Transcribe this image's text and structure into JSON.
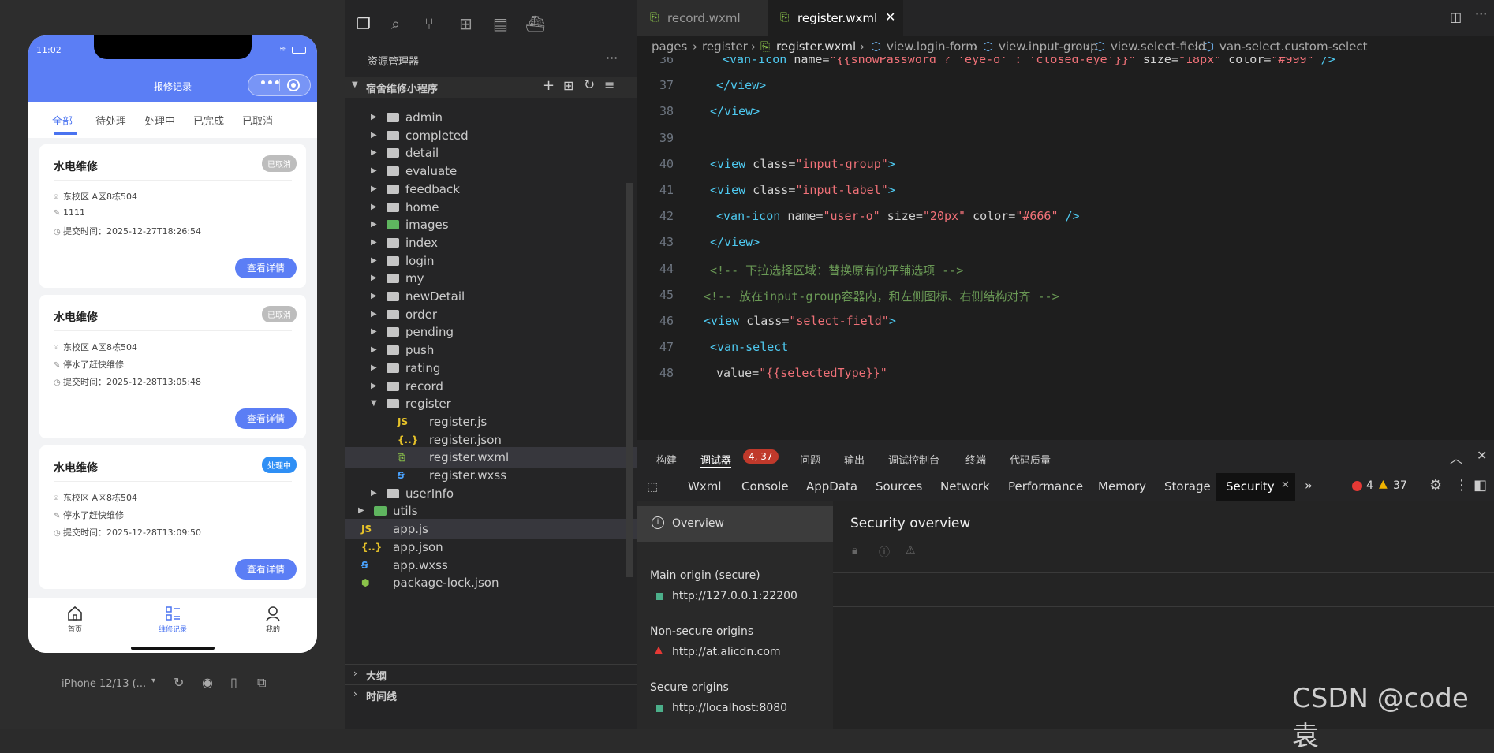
{
  "simulator": {
    "status_time": "11:02",
    "nav_title": "报修记录",
    "tabs": [
      "全部",
      "待处理",
      "处理中",
      "已完成",
      "已取消"
    ],
    "cards": [
      {
        "title": "水电维修",
        "badge": "已取消",
        "badge_color": "#bdbdbd",
        "location": "东校区 A区8栋504",
        "desc": "1111",
        "time": "提交时间：2025-12-27T18:26:54",
        "button": "查看详情"
      },
      {
        "title": "水电维修",
        "badge": "已取消",
        "badge_color": "#bdbdbd",
        "location": "东校区 A区8栋504",
        "desc": "停水了赶快维修",
        "time": "提交时间：2025-12-28T13:05:48",
        "button": "查看详情"
      },
      {
        "title": "水电维修",
        "badge": "处理中",
        "badge_color": "#2f8ff5",
        "location": "东校区 A区8栋504",
        "desc": "停水了赶快维修",
        "time": "提交时间：2025-12-28T13:09:50",
        "button": "查看详情"
      }
    ],
    "tabbar": [
      "首页",
      "维修记录",
      "我的"
    ],
    "device": "iPhone 12/13 (..."
  },
  "explorer": {
    "title": "资源管理器",
    "project": "宿舍维修小程序",
    "items": [
      {
        "name": "admin",
        "kind": "folder",
        "level": 1
      },
      {
        "name": "completed",
        "kind": "folder",
        "level": 1
      },
      {
        "name": "detail",
        "kind": "folder",
        "level": 1
      },
      {
        "name": "evaluate",
        "kind": "folder",
        "level": 1
      },
      {
        "name": "feedback",
        "kind": "folder",
        "level": 1
      },
      {
        "name": "home",
        "kind": "folder",
        "level": 1
      },
      {
        "name": "images",
        "kind": "folder-green",
        "level": 1
      },
      {
        "name": "index",
        "kind": "folder",
        "level": 1
      },
      {
        "name": "login",
        "kind": "folder",
        "level": 1
      },
      {
        "name": "my",
        "kind": "folder",
        "level": 1
      },
      {
        "name": "newDetail",
        "kind": "folder",
        "level": 1
      },
      {
        "name": "order",
        "kind": "folder",
        "level": 1
      },
      {
        "name": "pending",
        "kind": "folder",
        "level": 1
      },
      {
        "name": "push",
        "kind": "folder",
        "level": 1
      },
      {
        "name": "rating",
        "kind": "folder",
        "level": 1
      },
      {
        "name": "record",
        "kind": "folder",
        "level": 1
      },
      {
        "name": "register",
        "kind": "folder-open",
        "level": 1
      },
      {
        "name": "register.js",
        "kind": "js",
        "level": 2
      },
      {
        "name": "register.json",
        "kind": "json",
        "level": 2
      },
      {
        "name": "register.wxml",
        "kind": "wxml",
        "level": 2,
        "selected": true
      },
      {
        "name": "register.wxss",
        "kind": "wxss",
        "level": 2
      },
      {
        "name": "userInfo",
        "kind": "folder",
        "level": 1
      },
      {
        "name": "utils",
        "kind": "folder-green",
        "level": 0
      },
      {
        "name": "app.js",
        "kind": "js",
        "level": 0,
        "selected": true
      },
      {
        "name": "app.json",
        "kind": "json",
        "level": 0
      },
      {
        "name": "app.wxss",
        "kind": "wxss",
        "level": 0
      },
      {
        "name": "package-lock.json",
        "kind": "pkg",
        "level": 0
      }
    ],
    "outline": "大纲",
    "timeline": "时间线"
  },
  "editor": {
    "tabs": [
      {
        "label": "record.wxml",
        "active": false
      },
      {
        "label": "register.wxml",
        "active": true
      }
    ],
    "breadcrumb": [
      "pages",
      "register",
      "register.wxml",
      "view.login-form",
      "view.input-group",
      "view.select-field",
      "van-select.custom-select"
    ],
    "lines": [
      {
        "n": "36",
        "indent": 6,
        "parts": [
          [
            "t",
            "<van-icon "
          ],
          [
            "a",
            "name="
          ],
          [
            "s",
            "\"{{showPassword ? 'eye-o' : 'closed-eye'}}\""
          ],
          [
            "a",
            " size="
          ],
          [
            "s",
            "\"18px\""
          ],
          [
            "a",
            " color="
          ],
          [
            "s",
            "\"#999\""
          ],
          [
            "t",
            " />"
          ]
        ]
      },
      {
        "n": "37",
        "indent": 5,
        "parts": [
          [
            "t",
            "</view>"
          ]
        ]
      },
      {
        "n": "38",
        "indent": 4,
        "parts": [
          [
            "t",
            "</view>"
          ]
        ]
      },
      {
        "n": "39",
        "indent": 0,
        "parts": []
      },
      {
        "n": "40",
        "indent": 4,
        "parts": [
          [
            "t",
            "<view "
          ],
          [
            "a",
            "class="
          ],
          [
            "s",
            "\"input-group\""
          ],
          [
            "t",
            ">"
          ]
        ]
      },
      {
        "n": "41",
        "indent": 4,
        "parts": [
          [
            "t",
            "<view "
          ],
          [
            "a",
            "class="
          ],
          [
            "s",
            "\"input-label\""
          ],
          [
            "t",
            ">"
          ]
        ]
      },
      {
        "n": "42",
        "indent": 5,
        "parts": [
          [
            "t",
            "<van-icon "
          ],
          [
            "a",
            "name="
          ],
          [
            "s",
            "\"user-o\""
          ],
          [
            "a",
            " size="
          ],
          [
            "s",
            "\"20px\""
          ],
          [
            "a",
            " color="
          ],
          [
            "s",
            "\"#666\""
          ],
          [
            "t",
            " />"
          ]
        ]
      },
      {
        "n": "43",
        "indent": 4,
        "parts": [
          [
            "t",
            "</view>"
          ]
        ]
      },
      {
        "n": "44",
        "indent": 4,
        "parts": [
          [
            "c",
            "<!-- 下拉选择区域：替换原有的平铺选项 -->"
          ]
        ]
      },
      {
        "n": "45",
        "indent": 3,
        "parts": [
          [
            "c",
            "<!-- 放在input-group容器内，和左侧图标、右侧结构对齐 -->"
          ]
        ]
      },
      {
        "n": "46",
        "indent": 3,
        "parts": [
          [
            "t",
            "<view "
          ],
          [
            "a",
            "class="
          ],
          [
            "s",
            "\"select-field\""
          ],
          [
            "t",
            ">"
          ]
        ]
      },
      {
        "n": "47",
        "indent": 4,
        "parts": [
          [
            "t",
            "<van-select"
          ]
        ]
      },
      {
        "n": "48",
        "indent": 5,
        "parts": [
          [
            "a",
            "value="
          ],
          [
            "s",
            "\"{{selectedType}}\""
          ]
        ]
      }
    ]
  },
  "devtools": {
    "head_tabs": [
      "构建",
      "调试器",
      "问题",
      "输出",
      "调试控制台",
      "终端",
      "代码质量"
    ],
    "debugger_badge": "4, 37",
    "tabs": [
      "Wxml",
      "Console",
      "AppData",
      "Sources",
      "Network",
      "Performance",
      "Memory",
      "Storage",
      "Security"
    ],
    "errors": "4",
    "warnings": "37",
    "overview": "Overview",
    "security_title": "Security overview",
    "main_origin_label": "Main origin (secure)",
    "main_origin": "http://127.0.0.1:22200",
    "nonsecure_label": "Non-secure origins",
    "nonsecure_origin": "http://at.alicdn.com",
    "secure_label": "Secure origins",
    "secure_origin": "http://localhost:8080"
  },
  "watermark": "CSDN @code袁"
}
